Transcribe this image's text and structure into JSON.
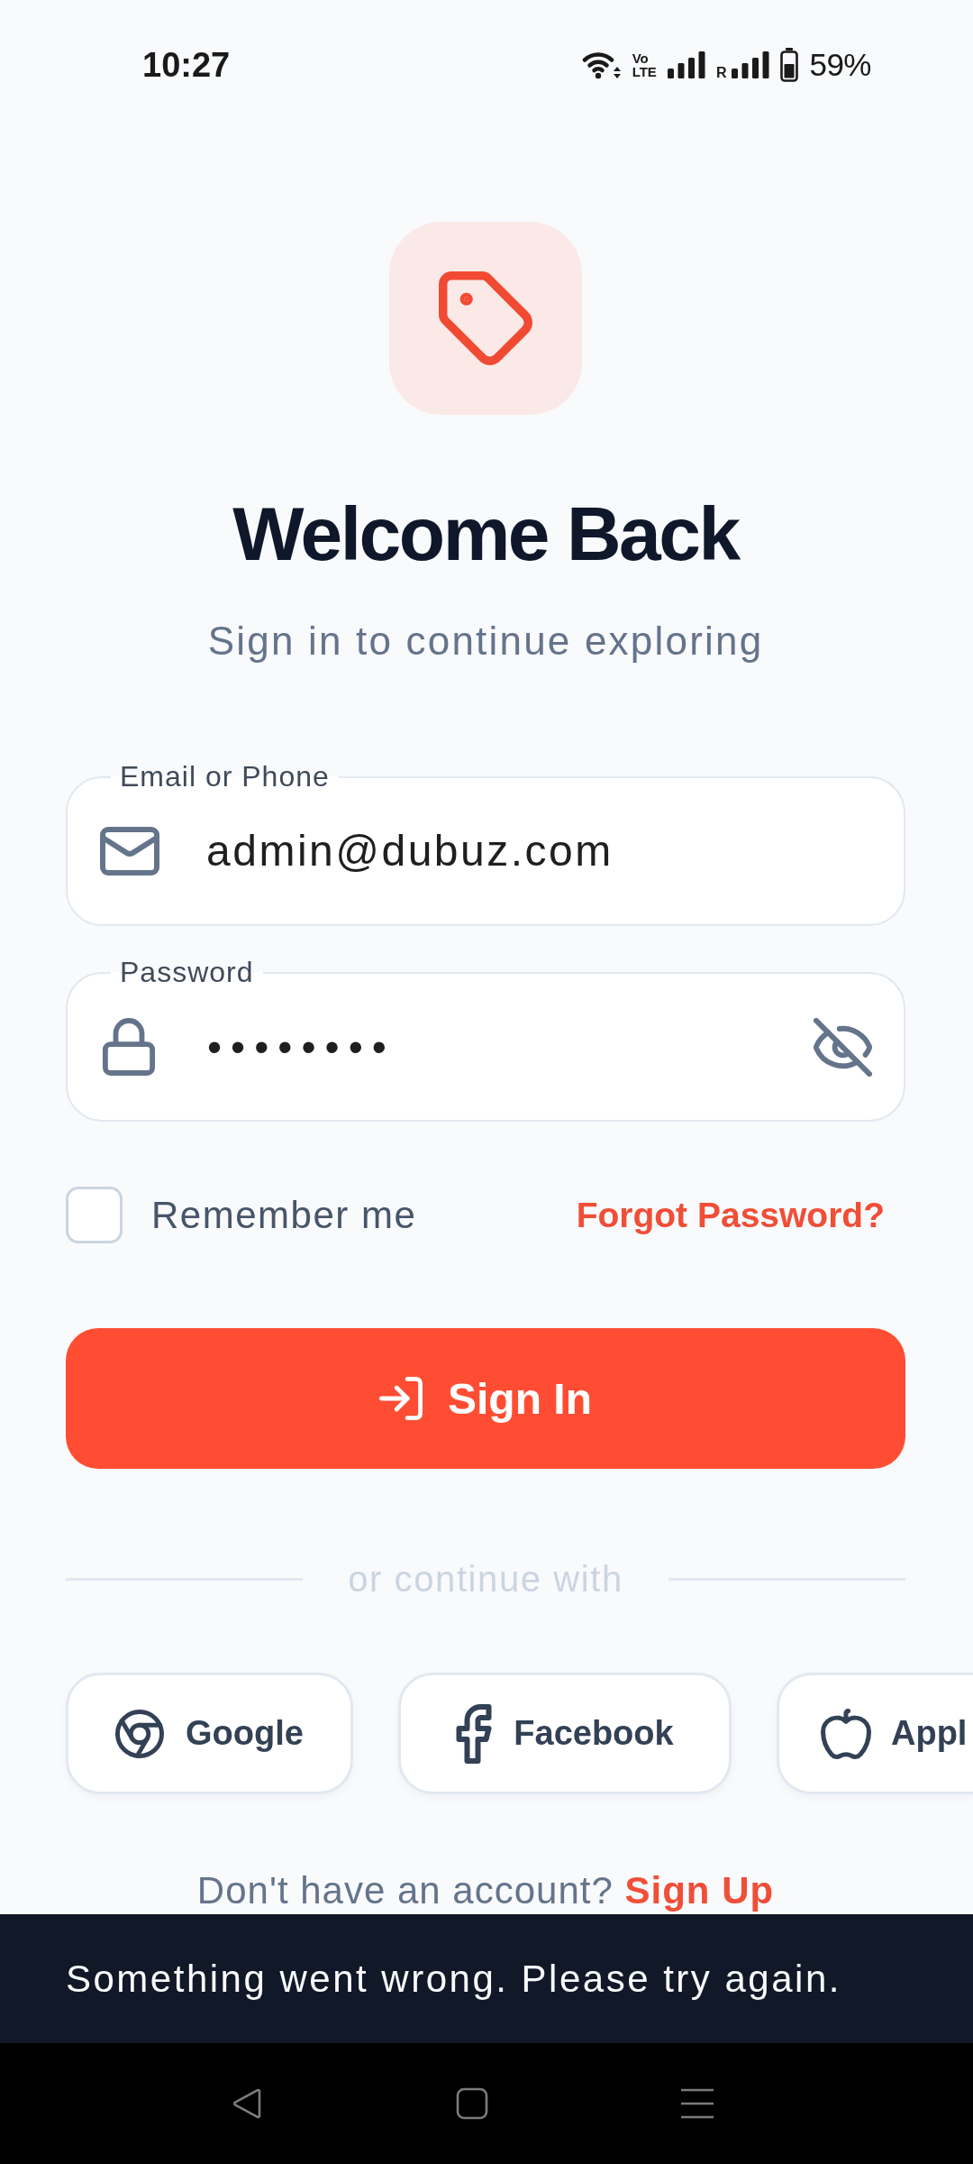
{
  "status_bar": {
    "time": "10:27",
    "network_badge": {
      "top": "Vo",
      "bottom": "LTE"
    },
    "roaming_label": "R",
    "battery": "59%"
  },
  "header": {
    "title": "Welcome Back",
    "subtitle": "Sign in to continue exploring"
  },
  "fields": [
    {
      "kind": "email",
      "label": "Email or Phone",
      "value": "admin@dubuz.com"
    },
    {
      "kind": "password",
      "label": "Password",
      "value": "••••••••"
    }
  ],
  "remember_me": {
    "label": "Remember me",
    "checked": false
  },
  "forgot_password": "Forgot Password?",
  "sign_in_button": "Sign In",
  "divider_text": "or continue with",
  "social_buttons": [
    {
      "kind": "google",
      "label": "Google"
    },
    {
      "kind": "facebook",
      "label": "Facebook"
    },
    {
      "kind": "apple",
      "label": "Appl"
    }
  ],
  "sign_up_prompt": {
    "text": "Don't have an account?",
    "link": "Sign Up"
  },
  "snackbar": {
    "message": "Something went wrong. Please try again."
  }
}
